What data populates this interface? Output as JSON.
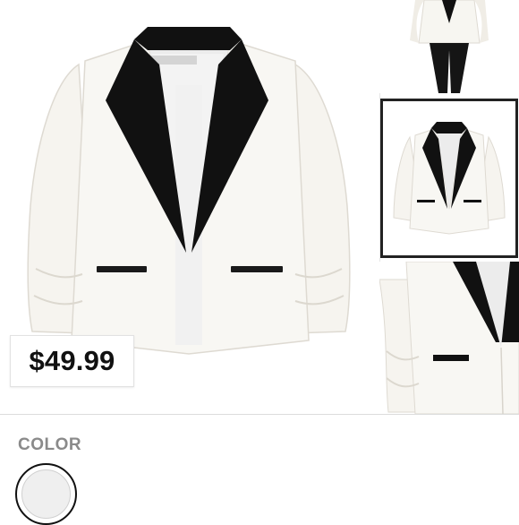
{
  "product": {
    "price": "$49.99",
    "main_image": {
      "icon": "white-tuxedo-blazer-image"
    },
    "thumbnails": [
      {
        "icon": "model-wearing-blazer-thumbnail"
      },
      {
        "icon": "blazer-front-thumbnail",
        "selected": true
      },
      {
        "icon": "blazer-detail-thumbnail"
      }
    ]
  },
  "color_section": {
    "label": "COLOR",
    "swatches": [
      {
        "color": "#efefef",
        "selected": true
      }
    ]
  }
}
